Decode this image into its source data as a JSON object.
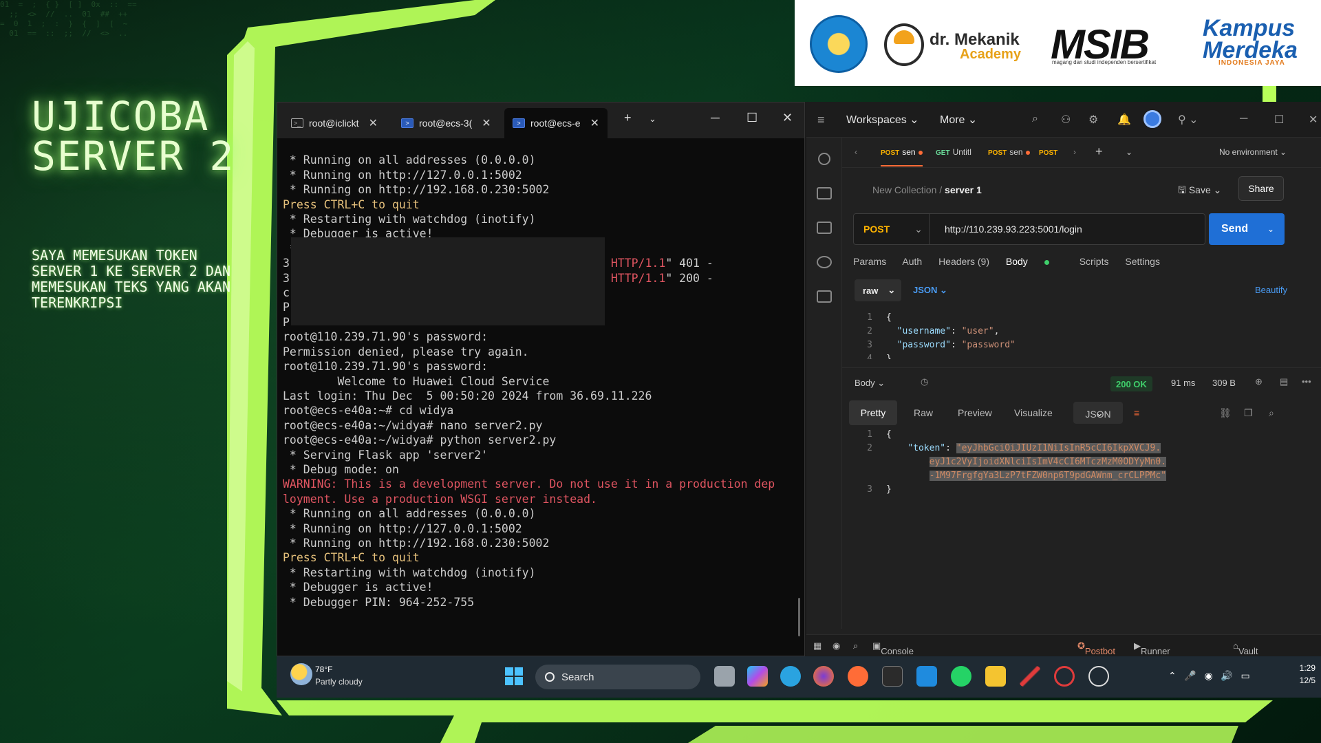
{
  "slide": {
    "title_line1": "UJICOBA",
    "title_line2": "SERVER 2",
    "subtitle": "SAYA MEMESUKAN TOKEN SERVER 1 KE SERVER 2 DAN MEMESUKAN TEKS YANG AKAN TERENKRIPSI"
  },
  "logos": {
    "mekanik_name": "dr. Mekanik",
    "mekanik_sub": "Academy",
    "msib": "MSIB",
    "msib_sub": "magang dan studi independen bersertifikat",
    "kampus_top": "Kampus",
    "kampus_bottom": "Merdeka",
    "kampus_tag": "INDONESIA JAYA"
  },
  "terminal": {
    "tabs": [
      {
        "label": "root@iclickt",
        "icon": "terminal-icon"
      },
      {
        "label": "root@ecs-3(",
        "icon": "powershell-icon"
      },
      {
        "label": "root@ecs-e",
        "icon": "powershell-icon"
      }
    ],
    "lines_top": [
      " * Running on all addresses (0.0.0.0)",
      " * Running on http://127.0.0.1:5002",
      " * Running on http://192.168.0.230:5002"
    ],
    "quit_1": "Press CTRL+C to quit",
    "lines_mid": [
      " * Restarting with watchdog (inotify)",
      " * Debugger is active!",
      " * Debugger PIN: 964-252-755"
    ],
    "encrypt_401": "/encrypt HTTP/1.1\" 401 -",
    "encrypt_200": "/encrypt HTTP/1.1\" 200 -",
    "lines_after": [
      "root@110.239.71.90's password:",
      "Permission denied, please try again.",
      "root@110.239.71.90's password:",
      "",
      "        Welcome to Huawei Cloud Service",
      "",
      "Last login: Thu Dec  5 00:50:20 2024 from 36.69.11.226",
      "root@ecs-e40a:~# cd widya",
      "root@ecs-e40a:~/widya# nano server2.py",
      "root@ecs-e40a:~/widya# python server2.py",
      " * Serving Flask app 'server2'",
      " * Debug mode: on"
    ],
    "warning": "WARNING: This is a development server. Do not use it in a production dep\nloyment. Use a production WSGI server instead.",
    "lines_run2": [
      " * Running on all addresses (0.0.0.0)",
      " * Running on http://127.0.0.1:5002",
      " * Running on http://192.168.0.230:5002"
    ],
    "quit_2": "Press CTRL+C to quit",
    "lines_end": [
      " * Restarting with watchdog (inotify)",
      " * Debugger is active!",
      " * Debugger PIN: 964-252-755"
    ]
  },
  "postman": {
    "workspaces": "Workspaces",
    "more": "More",
    "tabs": [
      {
        "method": "POST",
        "label": "sen"
      },
      {
        "method": "GET",
        "label": "Untitl"
      },
      {
        "method": "POST",
        "label": "sen"
      },
      {
        "method": "POST",
        "label": ""
      }
    ],
    "environment": "No environment",
    "breadcrumb_collection": "New Collection",
    "breadcrumb_sep": "/",
    "breadcrumb_request": "server 1",
    "save": "Save",
    "share": "Share",
    "method": "POST",
    "url": "http://110.239.93.223:5001/login",
    "send": "Send",
    "req_tabs": {
      "params": "Params",
      "auth": "Auth",
      "headers": "Headers (9)",
      "body": "Body",
      "scripts": "Scripts",
      "settings": "Settings"
    },
    "body_mode": "raw",
    "body_format": "JSON",
    "beautify": "Beautify",
    "request_body": {
      "l1": "{",
      "username_key": "\"username\"",
      "username_val": "\"user\"",
      "password_key": "\"password\"",
      "password_val": "\"password\"",
      "l4": "}"
    },
    "response": {
      "label": "Body",
      "status": "200 OK",
      "time": "91 ms",
      "size": "309 B",
      "tabs": {
        "pretty": "Pretty",
        "raw": "Raw",
        "preview": "Preview",
        "visualize": "Visualize",
        "format": "JSON"
      },
      "l1": "{",
      "token_key": "\"token\"",
      "token_1": "\"eyJhbGciOiJIUzI1NiIsInR5cCI6IkpXVCJ9.",
      "token_2": "eyJ1c2VyIjoidXNlciIsImV4cCI6MTczMzM0ODYyMn0.",
      "token_3": "-1M97FrgfgYa3LzP7tFZW0np6T9pdGAWnm_crCLPPMc\"",
      "l3": "}"
    },
    "bottom": {
      "console": "Console",
      "postbot": "Postbot",
      "runner": "Runner",
      "vault": "Vault"
    }
  },
  "taskbar": {
    "temp": "78°F",
    "condition": "Partly cloudy",
    "search": "Search",
    "time": "1:29",
    "date": "12/5"
  }
}
